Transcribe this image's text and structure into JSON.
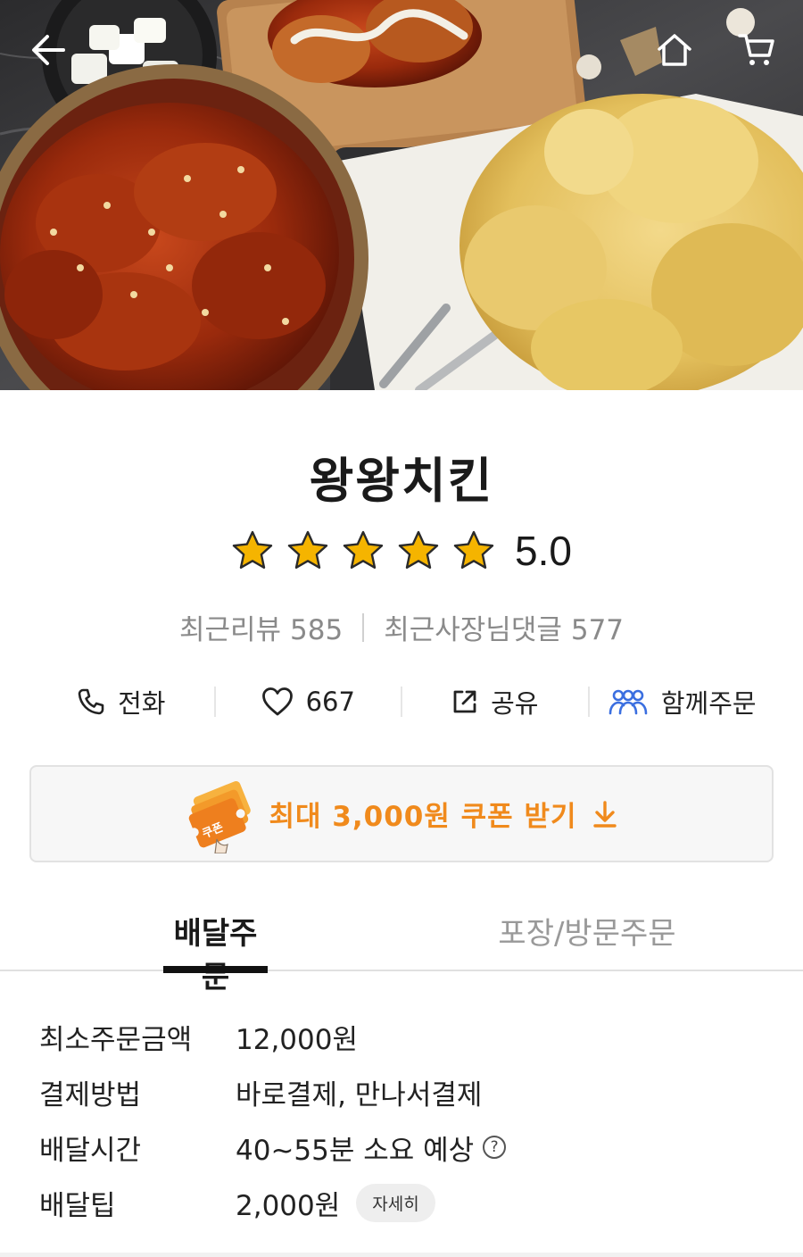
{
  "store": {
    "name": "왕왕치킨",
    "rating": "5.0",
    "star_count": 5,
    "recent_reviews_label": "최근리뷰",
    "recent_reviews_count": "585",
    "owner_replies_label": "최근사장님댓글",
    "owner_replies_count": "577"
  },
  "actions": {
    "call_label": "전화",
    "like_count": "667",
    "share_label": "공유",
    "group_order_label": "함께주문"
  },
  "coupon": {
    "badge_text": "쿠폰",
    "label": "최대 3,000원 쿠폰 받기"
  },
  "tabs": {
    "delivery": "배달주문",
    "pickup": "포장/방문주문"
  },
  "info": {
    "min_order_label": "최소주문금액",
    "min_order_value": "12,000원",
    "payment_label": "결제방법",
    "payment_value": "바로결제, 만나서결제",
    "delivery_time_label": "배달시간",
    "delivery_time_value": "40~55분 소요 예상",
    "help_glyph": "?",
    "delivery_tip_label": "배달팁",
    "delivery_tip_value": "2,000원",
    "detail_button": "자세히"
  },
  "colors": {
    "star": "#f5b400",
    "coupon_accent": "#f08a1c",
    "group_order_icon": "#3b6fe0"
  },
  "icons": {
    "back": "arrow-left-icon",
    "home": "home-icon",
    "cart": "cart-icon",
    "call": "phone-icon",
    "like": "heart-icon",
    "share": "share-icon",
    "group_order": "people-icon",
    "download": "download-arrow-icon",
    "help": "question-circle-icon"
  }
}
